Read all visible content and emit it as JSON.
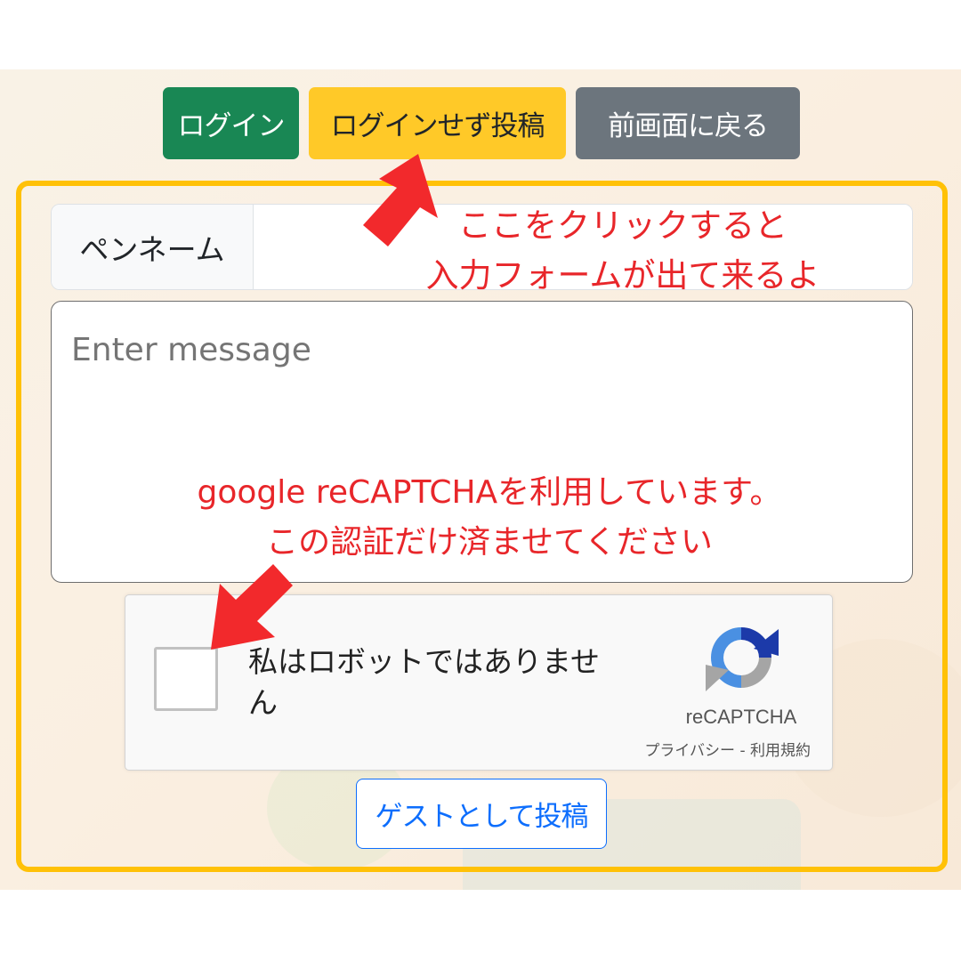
{
  "header_buttons": {
    "login": "ログイン",
    "post_without_login": "ログインせず投稿",
    "back": "前画面に戻る"
  },
  "form": {
    "penname_label": "ペンネーム",
    "penname_value": "",
    "message_placeholder": "Enter message",
    "submit_guest": "ゲストとして投稿"
  },
  "recaptcha": {
    "checkbox_label": "私はロボットではありません",
    "brand": "reCAPTCHA",
    "links": "プライバシー - 利用規約"
  },
  "annotations": {
    "click_hint_line1": "ここをクリックすると",
    "click_hint_line2": "入力フォームが出て来るよ",
    "captcha_hint_line1": "google reCAPTCHAを利用しています。",
    "captcha_hint_line2": "この認証だけ済ませてください"
  },
  "colors": {
    "login": "#198754",
    "post_without_login": "#ffc928",
    "back": "#6c757d",
    "frame": "#ffc107",
    "annotation": "#e8262a",
    "submit": "#0d6efd"
  }
}
